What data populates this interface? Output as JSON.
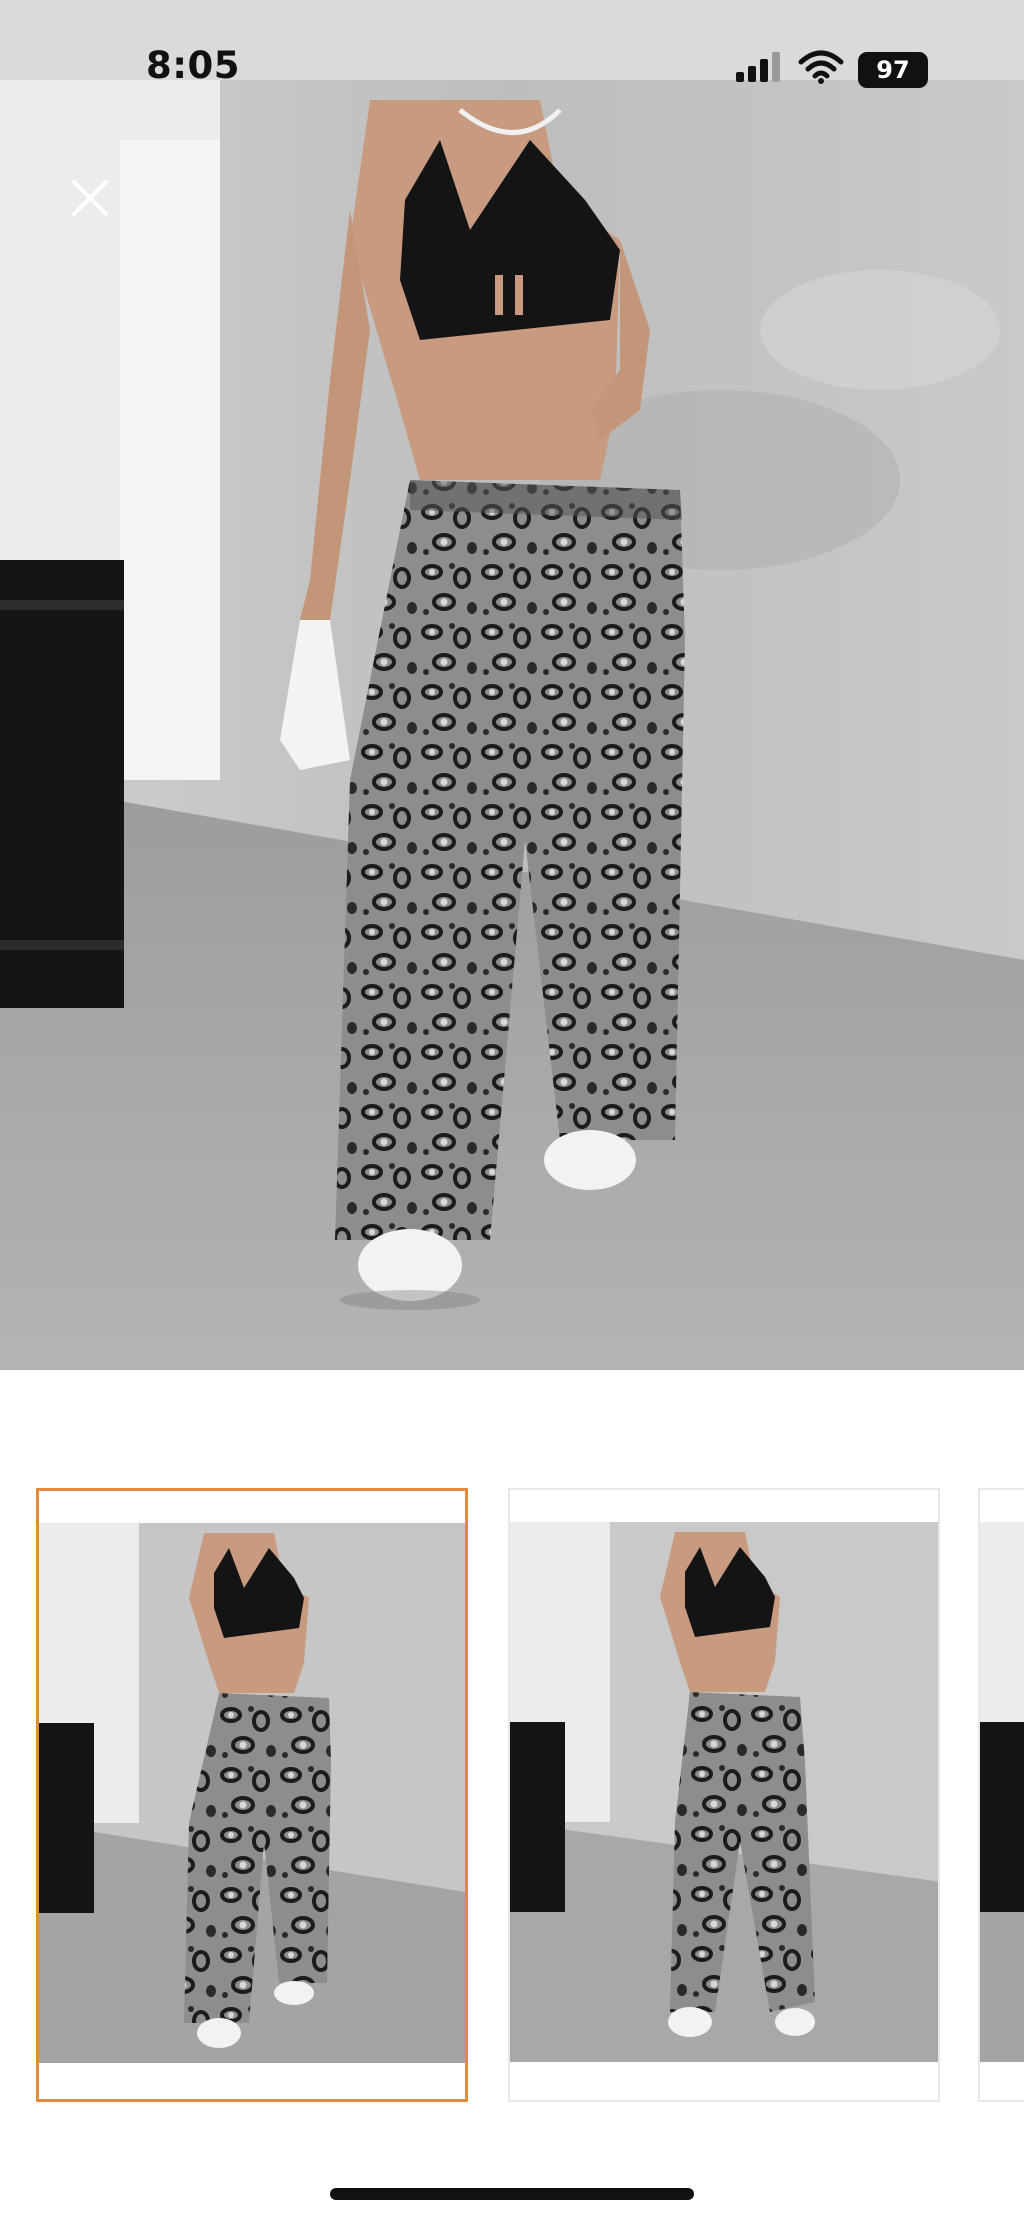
{
  "status_bar": {
    "time": "8:05",
    "battery_level": "97",
    "icons": [
      "signal-icon",
      "wifi-icon",
      "battery-icon"
    ]
  },
  "viewer": {
    "close_icon": "close-icon",
    "main_image": "product-photo-leopard-wide-leg-jeans",
    "thumbnails": [
      {
        "image": "thumbnail-photo-front",
        "selected": true
      },
      {
        "image": "thumbnail-photo-front-alt",
        "selected": false
      },
      {
        "image": "thumbnail-photo-partial",
        "selected": false
      }
    ]
  },
  "colors": {
    "selected_border": "#e28a3c",
    "status_bar_bg": "#dadada"
  }
}
